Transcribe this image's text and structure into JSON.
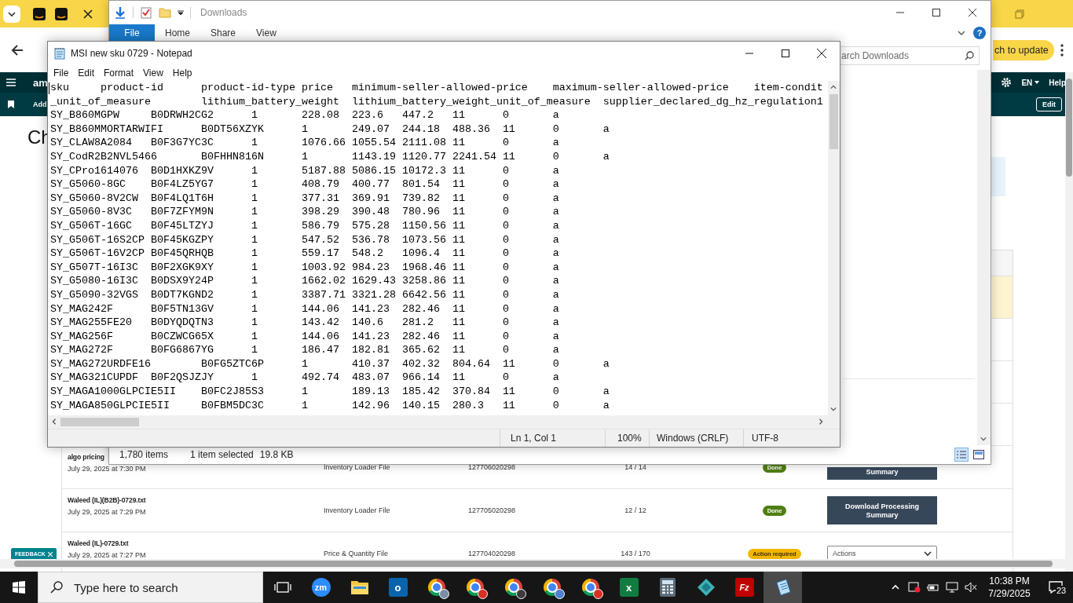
{
  "browser": {
    "update_button": "ch to update",
    "nav": {
      "logo": "am",
      "language": "EN",
      "help": "Help"
    },
    "subnav": {
      "link": "Add",
      "edit_button": "Edit"
    },
    "heading": "Ch",
    "highlighted_row": {
      "selected": true
    },
    "uploads": [
      {
        "name": "algo pricing",
        "date": "July 29, 2025 at 7:30 PM",
        "file_type": "Inventory Loader File",
        "batch_id": "127706020298",
        "records": "14 / 14",
        "status": {
          "text": "Done",
          "kind": "done"
        },
        "action": {
          "label": "Summary",
          "kind": "button"
        }
      },
      {
        "name": "Waleed (IL)(B2B)-0729.txt",
        "date": "July 29, 2025 at 7:29 PM",
        "file_type": "Inventory Loader File",
        "batch_id": "127705020298",
        "records": "12 / 12",
        "status": {
          "text": "Done",
          "kind": "done"
        },
        "action": {
          "label": "Download Processing Summary",
          "kind": "button"
        }
      },
      {
        "name": "Waleed (IL)-0729.txt",
        "date": "July 29, 2025 at 7:27 PM",
        "file_type": "Price & Quantity File",
        "batch_id": "127704020298",
        "records": "143 / 170",
        "status": {
          "text": "Action required",
          "kind": "warning"
        },
        "action": {
          "label": "Actions",
          "kind": "select"
        }
      }
    ],
    "feedback": "FEEDBACK"
  },
  "explorer": {
    "title": "Downloads",
    "ribbon_tabs": [
      {
        "label": "File",
        "kind": "menu"
      },
      {
        "label": "Home",
        "kind": "tab"
      },
      {
        "label": "Share",
        "kind": "tab"
      },
      {
        "label": "View",
        "kind": "tab"
      }
    ],
    "help": "?",
    "search": {
      "placeholder": "arch Downloads"
    },
    "status": {
      "items": "1,780 items",
      "selection": "1 item selected",
      "size": "19.8 KB"
    }
  },
  "notepad": {
    "title": "MSI new sku 0729 - Notepad",
    "menu": [
      "File",
      "Edit",
      "Format",
      "View",
      "Help"
    ],
    "lines": [
      "sku\tproduct-id\tproduct-id-type\tprice\tminimum-seller-allowed-price\tmaximum-seller-allowed-price\titem-condit",
      "_unit_of_measure\tlithium_battery_weight\tlithium_battery_weight_unit_of_measure\tsupplier_declared_dg_hz_regulation1",
      "SY_B860MGPW\tB0DRWH2CG2\t1\t228.08\t223.6\t447.2\t11\t0\ta",
      "SY_B860MMORTARWIFI\tB0DT56XZYK\t1\t249.07\t244.18\t488.36\t11\t0\ta",
      "SY_CLAW8A2084\tB0F3G7YC3C\t1\t1076.66\t1055.54\t2111.08\t11\t0\ta",
      "SY_CodR2B2NVL5466\tB0FHHN816N\t1\t1143.19\t1120.77\t2241.54\t11\t0\ta",
      "SY_CPro1614076\tB0D1HXKZ9V\t1\t5187.88\t5086.15\t10172.3\t11\t0\ta",
      "SY_G5060-8GC\tB0F4LZ5YG7\t1\t408.79\t400.77\t801.54\t11\t0\ta",
      "SY_G5060-8V2CW\tB0F4LQ1T6H\t1\t377.31\t369.91\t739.82\t11\t0\ta",
      "SY_G5060-8V3C\tB0F7ZFYM9N\t1\t398.29\t390.48\t780.96\t11\t0\ta",
      "SY_G506T-16GC\tB0F45LTZYJ\t1\t586.79\t575.28\t1150.56\t11\t0\ta",
      "SY_G506T-16S2CP\tB0F45KGZPY\t1\t547.52\t536.78\t1073.56\t11\t0\ta",
      "SY_G506T-16V2CP\tB0F45QRHQB\t1\t559.17\t548.2\t1096.4\t11\t0\ta",
      "SY_G507T-16I3C\tB0F2XGK9XY\t1\t1003.92\t984.23\t1968.46\t11\t0\ta",
      "SY_G5080-16I3C\tB0DSX9Y24P\t1\t1662.02\t1629.43\t3258.86\t11\t0\ta",
      "SY_G5090-32VGS\tB0DT7KGND2\t1\t3387.71\t3321.28\t6642.56\t11\t0\ta",
      "SY_MAG242F\tB0F5TN13GV\t1\t144.06\t141.23\t282.46\t11\t0\ta",
      "SY_MAG255FE20\tB0DYQDQTN3\t1\t143.42\t140.6\t281.2\t11\t0\ta",
      "SY_MAG256F\tB0CZWCG65X\t1\t144.06\t141.23\t282.46\t11\t0\ta",
      "SY_MAG272F\tB0FG6867YG\t1\t186.47\t182.81\t365.62\t11\t0\ta",
      "SY_MAG272URDFE16\tB0FG5ZTC6P\t1\t410.37\t402.32\t804.64\t11\t0\ta",
      "SY_MAG321CUPDF\tB0F2QSJZJY\t1\t492.74\t483.07\t966.14\t11\t0\ta",
      "SY_MAGA1000GLPCIE5II\tB0FC2J85S3\t1\t189.13\t185.42\t370.84\t11\t0\ta",
      "SY_MAGA850GLPCIE5II\tB0FBM5DC3C\t1\t142.96\t140.15\t280.3\t11\t0\ta"
    ],
    "status": {
      "position": "Ln 1, Col 1",
      "zoom": "100%",
      "line_ending": "Windows (CRLF)",
      "encoding": "UTF-8"
    }
  },
  "taskbar": {
    "search": {
      "placeholder": "Type here to search"
    },
    "apps": [
      {
        "kind": "task_view",
        "selected": false
      },
      {
        "kind": "zoom",
        "label": "zm",
        "selected": false
      },
      {
        "kind": "folder",
        "selected": false
      },
      {
        "kind": "mail",
        "label": "o",
        "selected": false
      },
      {
        "kind": "chrome",
        "color": "#7a8fa6",
        "selected": false
      },
      {
        "kind": "chrome",
        "color": "#d93025",
        "selected": false
      },
      {
        "kind": "chrome",
        "color": "#3c3c3c",
        "selected": false
      },
      {
        "kind": "chrome",
        "color": "#4f7fd0",
        "selected": false
      },
      {
        "kind": "chrome",
        "color": "#d93025",
        "selected": false
      },
      {
        "kind": "sheet",
        "label": "x",
        "selected": false
      },
      {
        "kind": "calculator",
        "selected": false
      },
      {
        "kind": "diamond",
        "selected": false
      },
      {
        "kind": "ftp",
        "label": "Fz",
        "selected": false
      },
      {
        "kind": "notepad",
        "selected": true
      }
    ],
    "time": "10:38 PM",
    "date": "7/29/2025",
    "notifications": "23"
  }
}
